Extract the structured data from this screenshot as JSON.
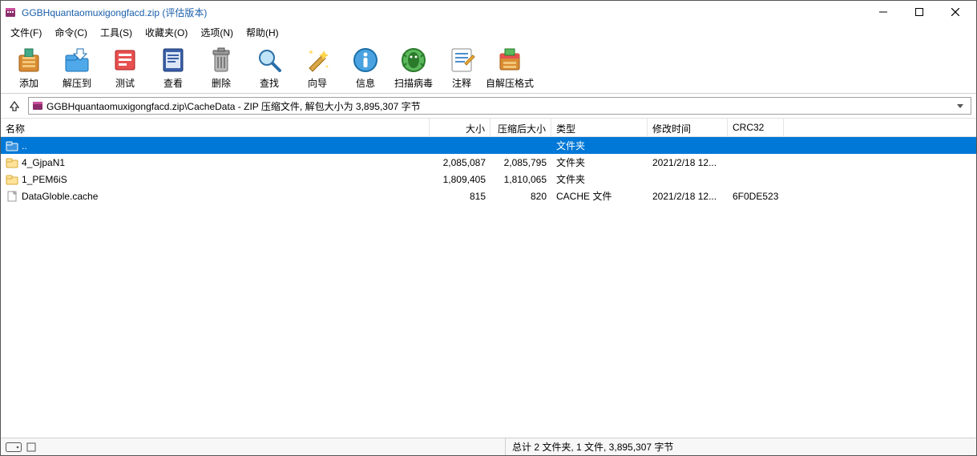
{
  "title": "GGBHquantaomuxigongfacd.zip (评估版本)",
  "menu": [
    "文件(F)",
    "命令(C)",
    "工具(S)",
    "收藏夹(O)",
    "选项(N)",
    "帮助(H)"
  ],
  "toolbar": [
    {
      "name": "add",
      "label": "添加"
    },
    {
      "name": "extract",
      "label": "解压到"
    },
    {
      "name": "test",
      "label": "测试"
    },
    {
      "name": "view",
      "label": "查看"
    },
    {
      "name": "delete",
      "label": "删除"
    },
    {
      "name": "find",
      "label": "查找"
    },
    {
      "name": "wizard",
      "label": "向导"
    },
    {
      "name": "info",
      "label": "信息"
    },
    {
      "name": "virusscan",
      "label": "扫描病毒"
    },
    {
      "name": "comment",
      "label": "注释"
    },
    {
      "name": "sfx",
      "label": "自解压格式"
    }
  ],
  "path": "GGBHquantaomuxigongfacd.zip\\CacheData - ZIP 压缩文件, 解包大小为 3,895,307 字节",
  "columns": {
    "name": "名称",
    "size": "大小",
    "packed": "压缩后大小",
    "type": "类型",
    "modified": "修改时间",
    "crc": "CRC32"
  },
  "rows": [
    {
      "icon": "updir",
      "name": "..",
      "size": "",
      "packed": "",
      "type": "文件夹",
      "modified": "",
      "crc": "",
      "selected": true
    },
    {
      "icon": "folder",
      "name": "4_GjpaN1",
      "size": "2,085,087",
      "packed": "2,085,795",
      "type": "文件夹",
      "modified": "2021/2/18 12...",
      "crc": ""
    },
    {
      "icon": "folder",
      "name": "1_PEM6iS",
      "size": "1,809,405",
      "packed": "1,810,065",
      "type": "文件夹",
      "modified": "",
      "crc": ""
    },
    {
      "icon": "file",
      "name": "DataGloble.cache",
      "size": "815",
      "packed": "820",
      "type": "CACHE 文件",
      "modified": "2021/2/18 12...",
      "crc": "6F0DE523"
    }
  ],
  "status": "总计 2 文件夹, 1 文件, 3,895,307 字节"
}
